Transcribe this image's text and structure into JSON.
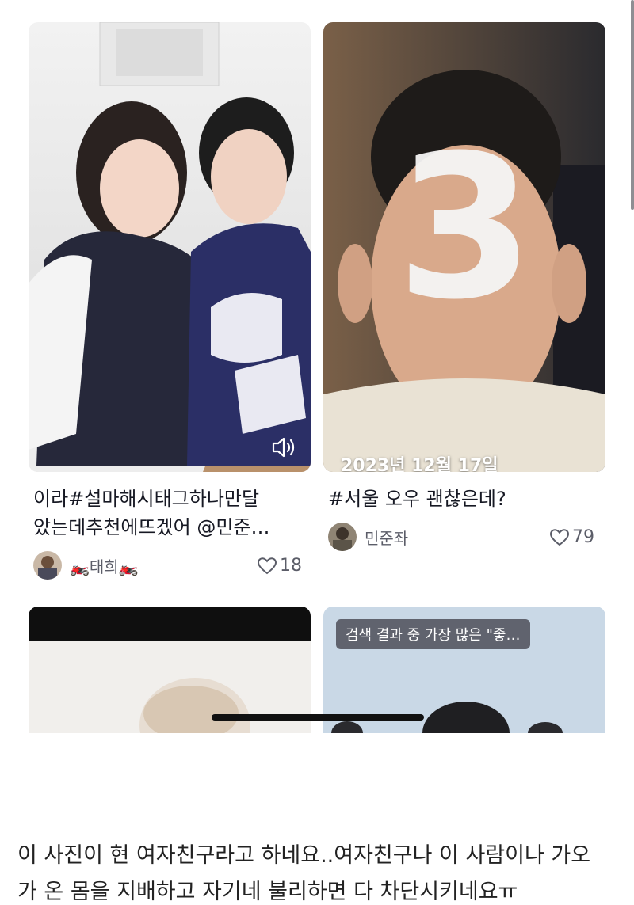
{
  "feed": {
    "cards": [
      {
        "caption_line1": "이라#설마해시태그하나만달",
        "caption_line2": "았는데추천에뜨겠어 @민준…",
        "author": "🏍️태희🏍️",
        "likes": "18",
        "has_sound_icon": true
      },
      {
        "overlay_number": "3",
        "overlay_date": "2023년 12월 17일",
        "caption_line1": "#서울 오우 괜찮은데?",
        "author": "민준좌",
        "likes": "79"
      },
      {
        "overlay_text": ""
      },
      {
        "overlay_text": "검색 결과 중 가장 많은 \"좋…"
      }
    ]
  },
  "post_text": {
    "line1": "이 사진이 현 여자친구라고 하네요..여자친구나 이 사람이나 가오",
    "line2": "가 온 몸을 지배하고 자기네 불리하면 다 차단시키네요ㅠ"
  },
  "colors": {
    "text_primary": "#161823",
    "text_secondary": "#5b5d68"
  },
  "icons": {
    "like": "heart-outline-icon",
    "sound": "speaker-icon"
  }
}
